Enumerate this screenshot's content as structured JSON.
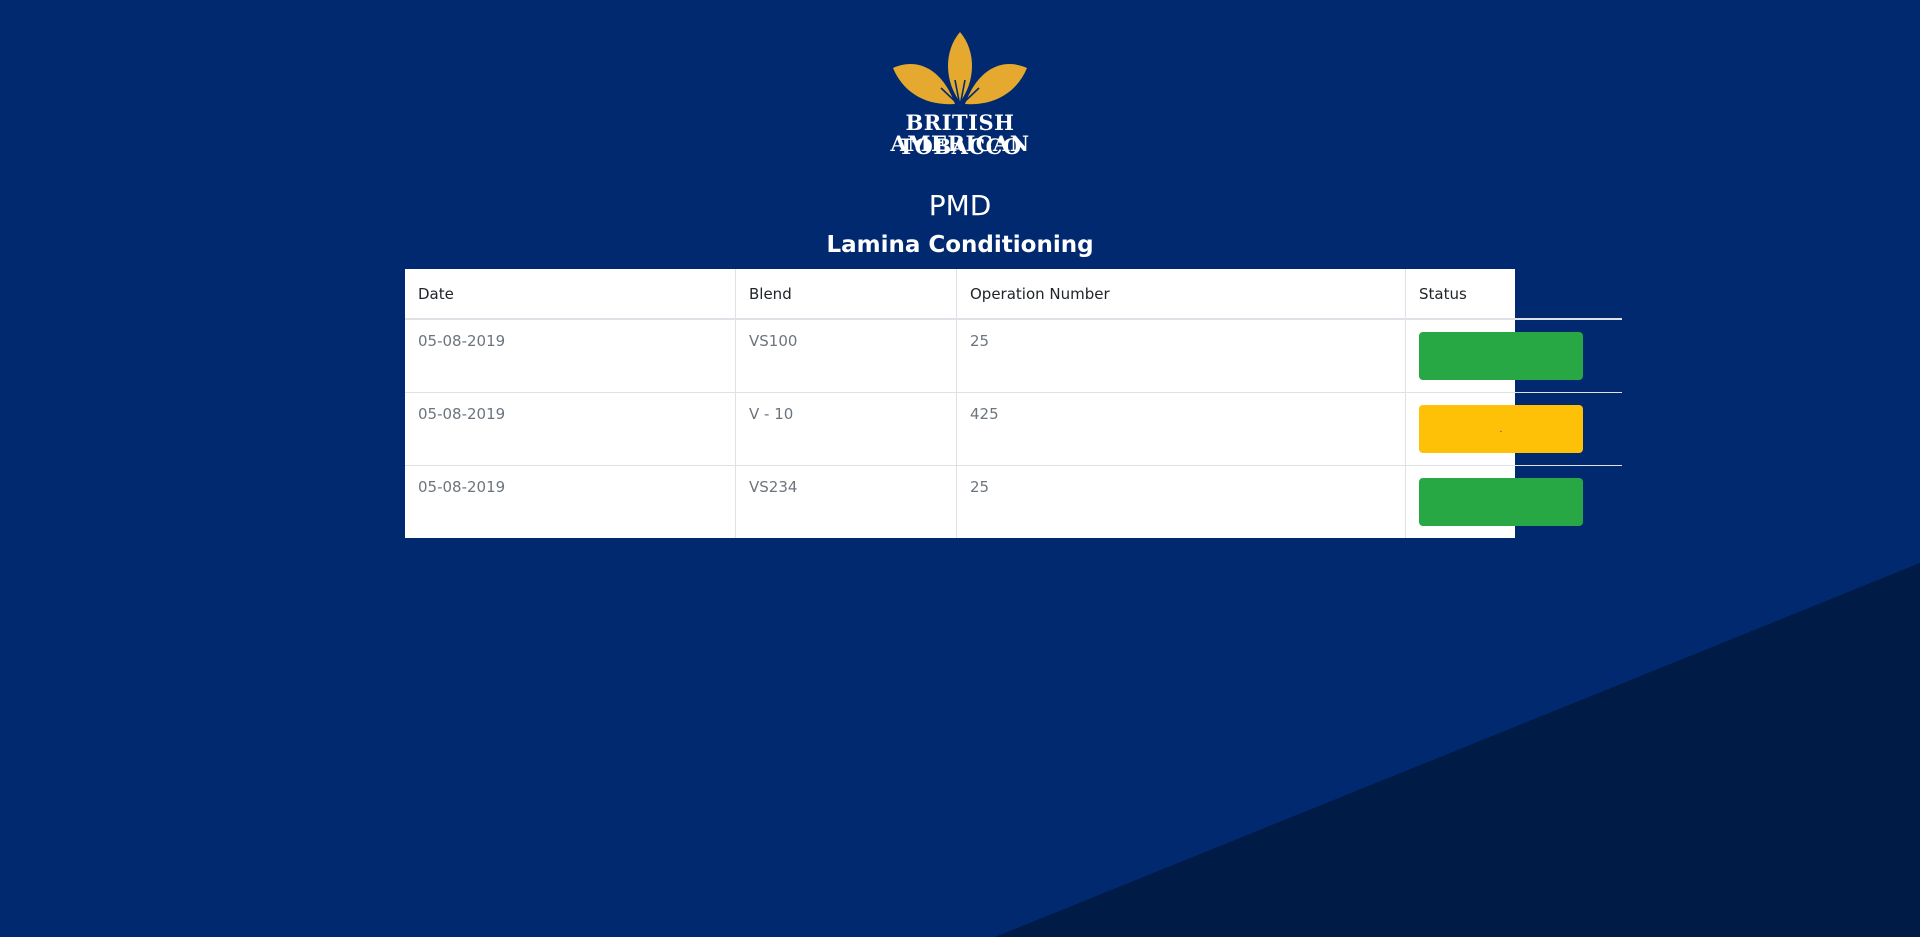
{
  "brand": {
    "logo_line1": "BRITISH AMERICAN",
    "logo_line2": "TOBACCO",
    "logo_color": "#E4A92E"
  },
  "header": {
    "title": "PMD",
    "subtitle": "Lamina Conditioning"
  },
  "table": {
    "columns": [
      "Date",
      "Blend",
      "Operation Number",
      "Status"
    ],
    "rows": [
      {
        "date": "05-08-2019",
        "blend": "VS100",
        "operation_number": "25",
        "status_color": "#28A745",
        "status_text": ""
      },
      {
        "date": "05-08-2019",
        "blend": "V - 10",
        "operation_number": "425",
        "status_color": "#FFC107",
        "status_text": "."
      },
      {
        "date": "05-08-2019",
        "blend": "VS234",
        "operation_number": "25",
        "status_color": "#28A745",
        "status_text": ""
      }
    ]
  },
  "colors": {
    "background": "#012970",
    "background_wedge": "#011B47"
  }
}
